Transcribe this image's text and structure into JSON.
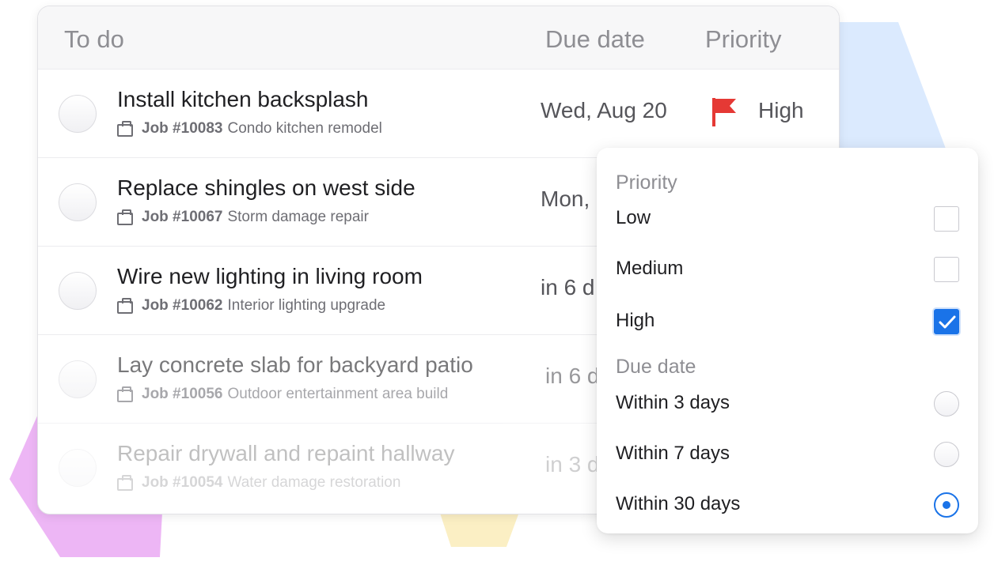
{
  "table": {
    "headers": {
      "todo": "To do",
      "due": "Due date",
      "priority": "Priority"
    },
    "rows": [
      {
        "title": "Install kitchen backsplash",
        "job": "Job #10083",
        "job_desc": "Condo kitchen remodel",
        "due": "Wed, Aug 20",
        "priority": "High",
        "flag_color": "#e53935"
      },
      {
        "title": "Replace shingles on west side",
        "job": "Job #10067",
        "job_desc": "Storm damage repair",
        "due": "Mon, ",
        "priority": ""
      },
      {
        "title": "Wire new lighting in living room",
        "job": "Job #10062",
        "job_desc": "Interior lighting upgrade",
        "due": "in 6 d",
        "priority": ""
      },
      {
        "title": "Lay concrete slab for backyard patio",
        "job": "Job #10056",
        "job_desc": "Outdoor entertainment area build",
        "due": "in 6 d",
        "priority": ""
      },
      {
        "title": "Repair drywall and repaint hallway",
        "job": "Job #10054",
        "job_desc": "Water damage restoration",
        "due": "in 3 d",
        "priority": ""
      }
    ]
  },
  "filter_panel": {
    "priority_heading": "Priority",
    "priority_options": [
      {
        "label": "Low",
        "checked": false
      },
      {
        "label": "Medium",
        "checked": false
      },
      {
        "label": "High",
        "checked": true
      }
    ],
    "due_heading": "Due date",
    "due_options": [
      {
        "label": "Within 3 days",
        "selected": false
      },
      {
        "label": "Within 7 days",
        "selected": false
      },
      {
        "label": "Within 30 days",
        "selected": true
      }
    ],
    "accent_color": "#1a73e8"
  },
  "icons": {
    "row_job": "briefcase-icon",
    "priority": "flag-icon",
    "checked": "checkmark-icon"
  }
}
